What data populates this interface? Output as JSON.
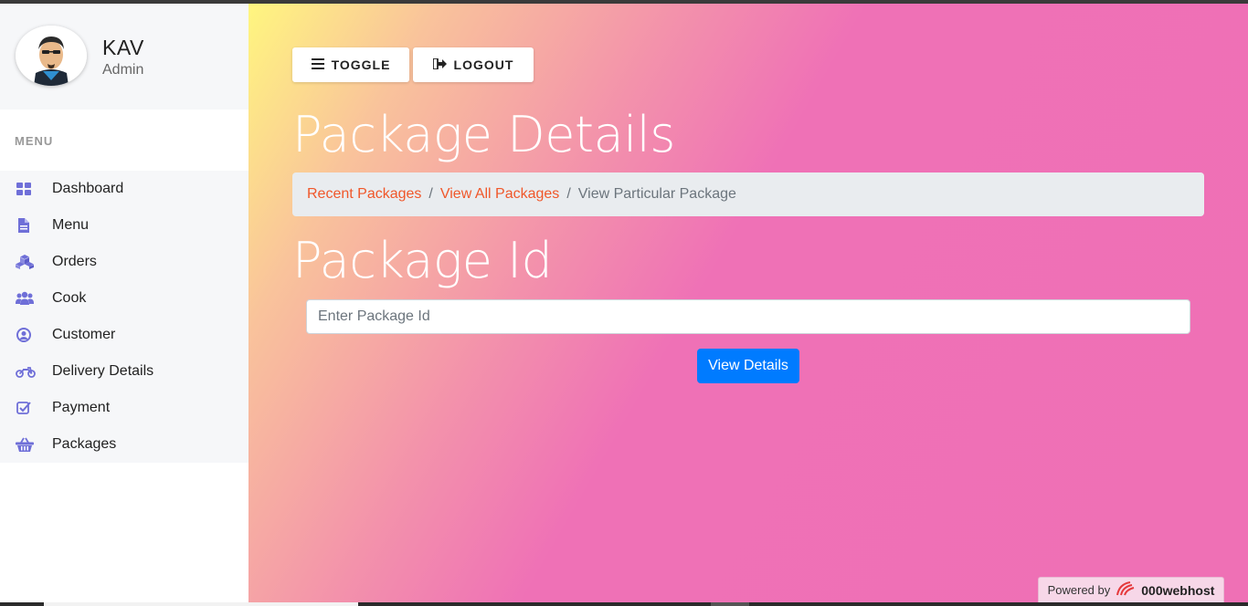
{
  "profile": {
    "name": "KAV",
    "role": "Admin"
  },
  "sidebar": {
    "heading": "MENU",
    "items": [
      {
        "label": "Dashboard",
        "icon": "dashboard-icon"
      },
      {
        "label": "Menu",
        "icon": "document-icon"
      },
      {
        "label": "Orders",
        "icon": "cubes-icon"
      },
      {
        "label": "Cook",
        "icon": "users-icon"
      },
      {
        "label": "Customer",
        "icon": "user-circle-icon"
      },
      {
        "label": "Delivery Details",
        "icon": "motorcycle-icon"
      },
      {
        "label": "Payment",
        "icon": "check-square-icon"
      },
      {
        "label": "Packages",
        "icon": "basket-icon"
      }
    ]
  },
  "toolbar": {
    "toggle_label": "TOGGLE",
    "logout_label": "LOGOUT"
  },
  "main": {
    "title": "Package Details",
    "breadcrumb": {
      "items": [
        "Recent Packages",
        "View All Packages"
      ],
      "active": "View Particular Package",
      "separator": "/"
    },
    "section_title": "Package Id",
    "input": {
      "placeholder": "Enter Package Id",
      "value": ""
    },
    "submit_label": "View Details"
  },
  "footer": {
    "powered_text": "Powered by",
    "brand": "000webhost"
  },
  "colors": {
    "accent": "#007bff",
    "link": "#f0572a",
    "icon": "#6f6fd8"
  }
}
